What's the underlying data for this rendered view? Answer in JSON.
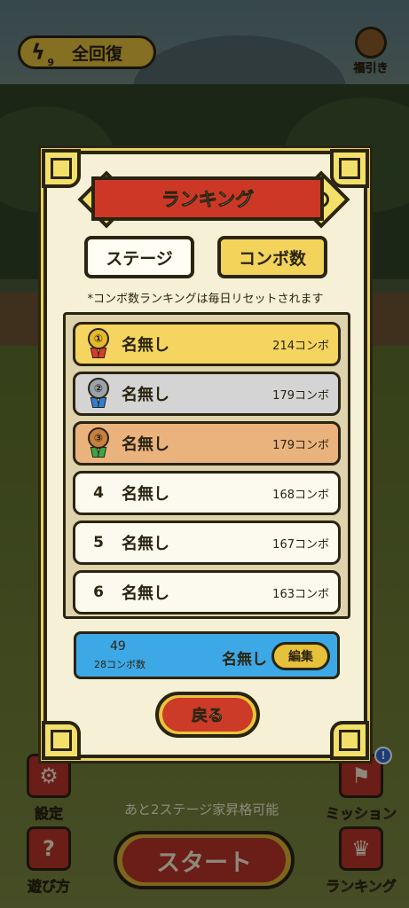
{
  "top_bar": {
    "energy_count": "9",
    "recover_label": "全回復",
    "gacha_label": "福引き"
  },
  "bottom_bar": {
    "settings_label": "設定",
    "howto_label": "遊び方",
    "mission_label": "ミッション",
    "ranking_label": "ランキング",
    "start_label": "スタート",
    "hint_text": "あと2ステージ家昇格可能",
    "mission_badge": "!",
    "howto_icon_text": "?"
  },
  "modal": {
    "title": "ランキング",
    "tabs": {
      "stage": "ステージ",
      "combo": "コンボ数"
    },
    "selected_tab": "combo",
    "note": "*コンボ数ランキングは毎日リセットされます",
    "rows": [
      {
        "rank": "1",
        "name": "名無し",
        "score": "214コンボ",
        "style": "gold"
      },
      {
        "rank": "2",
        "name": "名無し",
        "score": "179コンボ",
        "style": "silver"
      },
      {
        "rank": "3",
        "name": "名無し",
        "score": "179コンボ",
        "style": "bronze"
      },
      {
        "rank": "4",
        "name": "名無し",
        "score": "168コンボ",
        "style": "plain"
      },
      {
        "rank": "5",
        "name": "名無し",
        "score": "167コンボ",
        "style": "plain"
      },
      {
        "rank": "6",
        "name": "名無し",
        "score": "163コンボ",
        "style": "plain"
      }
    ],
    "self": {
      "rank": "49",
      "count": "28コンボ数",
      "name": "名無し",
      "edit_label": "編集"
    },
    "back_label": "戻る"
  },
  "colors": {
    "gold": "#f5d460",
    "silver": "#d4d4d4",
    "bronze": "#eab37e",
    "plain": "#fcf9ef",
    "self_panel": "#3da8e6",
    "banner": "#cd3826"
  }
}
